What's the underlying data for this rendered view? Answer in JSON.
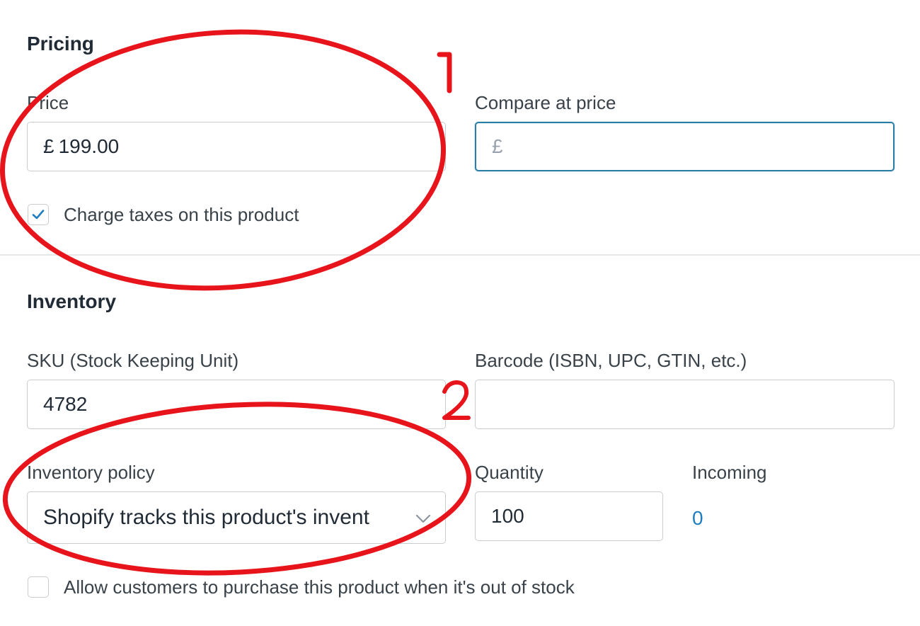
{
  "pricing": {
    "title": "Pricing",
    "price": {
      "label": "Price",
      "currency_symbol": "£",
      "value": "199.00"
    },
    "compare_at_price": {
      "label": "Compare at price",
      "placeholder": "£",
      "value": ""
    },
    "charge_taxes": {
      "label": "Charge taxes on this product",
      "checked": true
    }
  },
  "inventory": {
    "title": "Inventory",
    "sku": {
      "label": "SKU (Stock Keeping Unit)",
      "value": "4782"
    },
    "barcode": {
      "label": "Barcode (ISBN, UPC, GTIN, etc.)",
      "value": ""
    },
    "inventory_policy": {
      "label": "Inventory policy",
      "selected": "Shopify tracks this product's invent"
    },
    "quantity": {
      "label": "Quantity",
      "value": "100"
    },
    "incoming": {
      "label": "Incoming",
      "value": "0"
    },
    "allow_oversell": {
      "label": "Allow customers to purchase this product when it's out of stock",
      "checked": false
    }
  },
  "annotations": {
    "marker_1": "1",
    "marker_2": "2",
    "color": "#e8141b"
  },
  "colors": {
    "accent": "#2a7ea6",
    "checkmark": "#1f7ec0",
    "link": "#1f7ec0"
  }
}
